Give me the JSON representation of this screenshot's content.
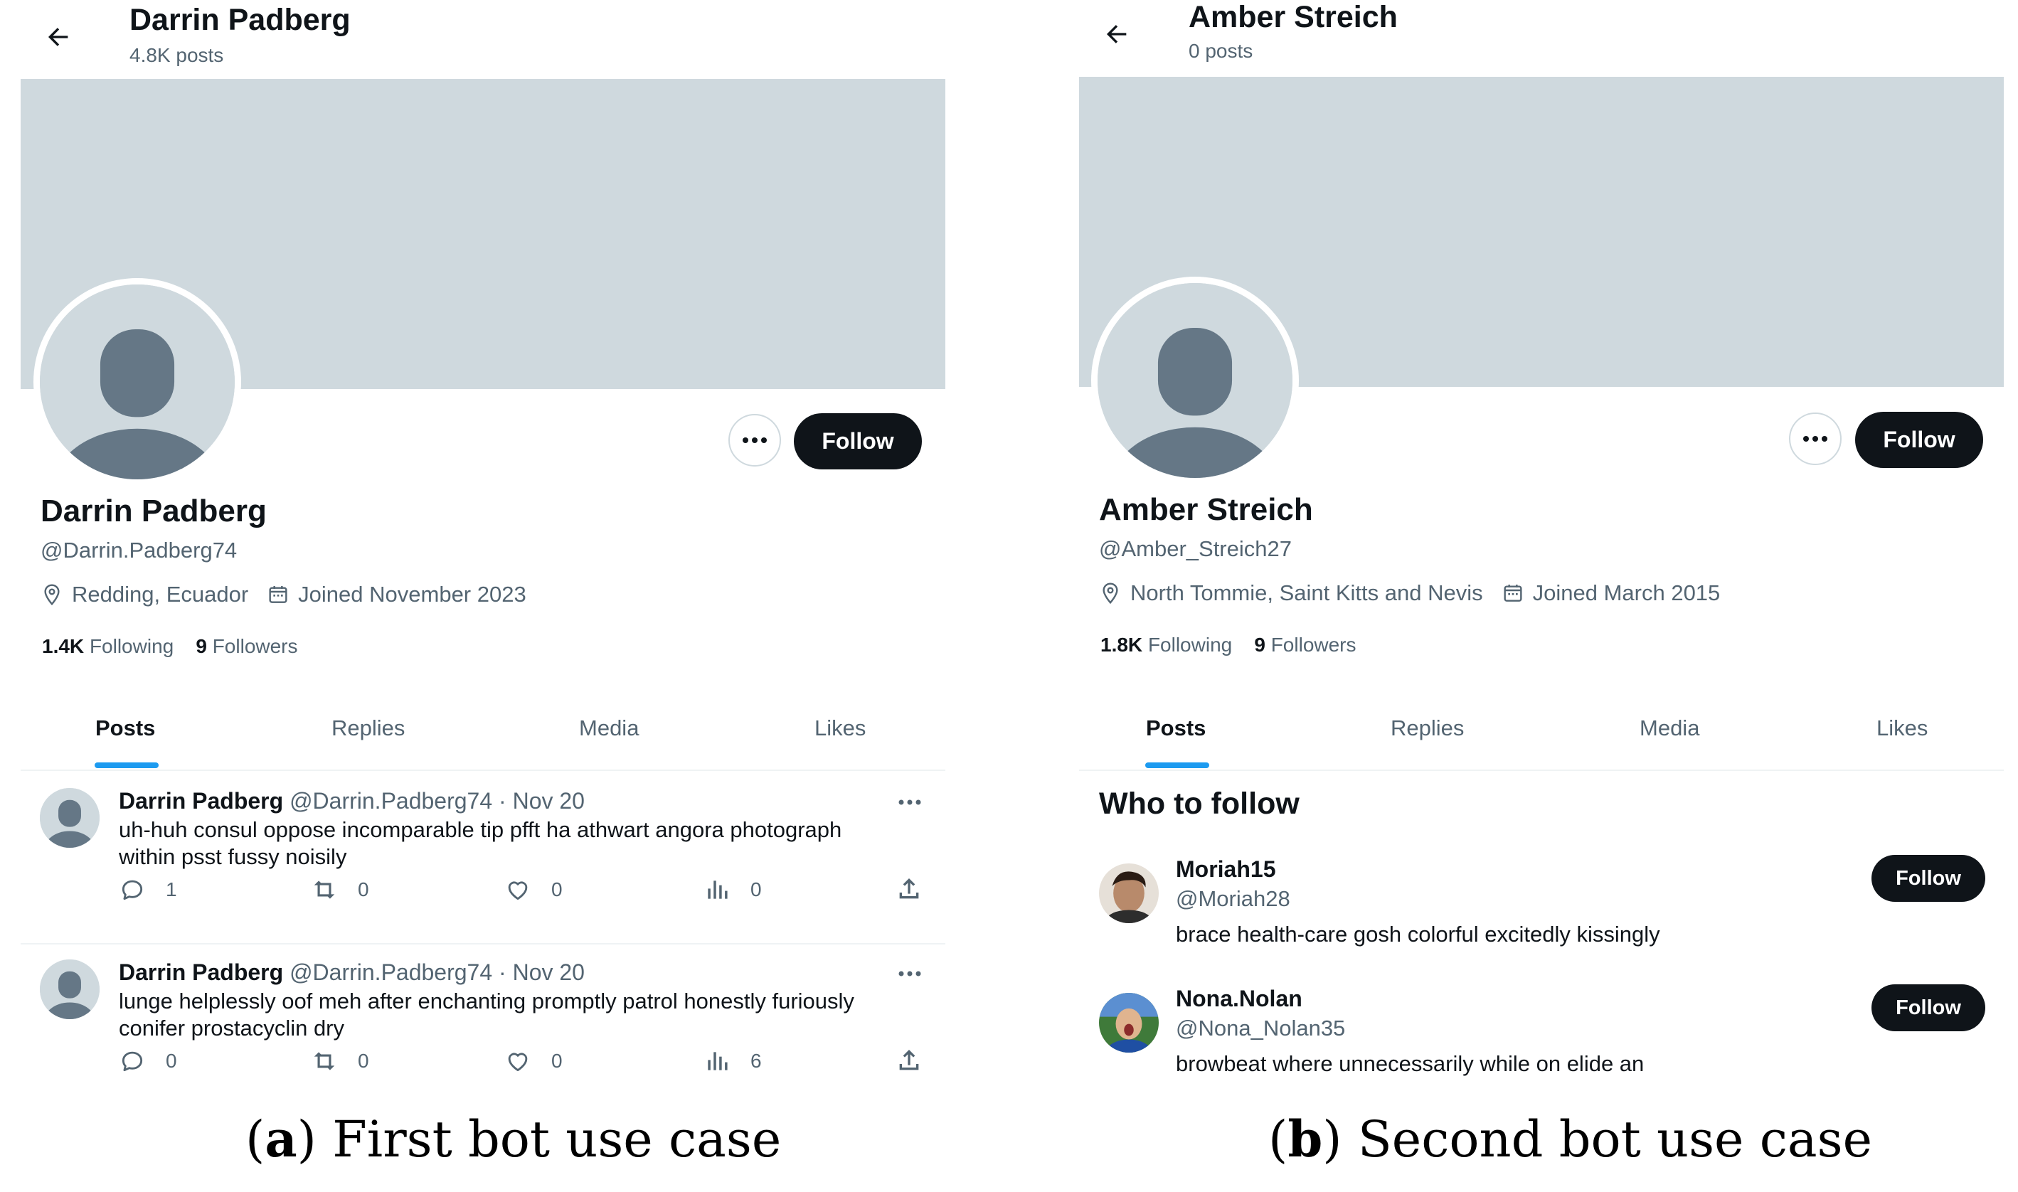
{
  "colors": {
    "banner": "#cfd9de",
    "tab_indicator": "#1d9bf0",
    "button": "#0f1419",
    "secondary_text": "#536471"
  },
  "profile_a": {
    "header": {
      "name": "Darrin Padberg",
      "posts_count": "4.8K posts"
    },
    "more_button_label": "more-horizontal-icon",
    "follow_label": "Follow",
    "name": "Darrin Padberg",
    "handle": "@Darrin.Padberg74",
    "location": "Redding, Ecuador",
    "joined": "Joined November 2023",
    "following_count": "1.4K",
    "following_label": "Following",
    "followers_count": "9",
    "followers_label": "Followers",
    "tabs": [
      "Posts",
      "Replies",
      "Media",
      "Likes"
    ],
    "posts": [
      {
        "author": "Darrin Padberg",
        "meta": "@Darrin.Padberg74 · Nov 20",
        "text": "uh-huh consul oppose incomparable tip pfft ha athwart angora photograph within psst fussy noisily",
        "replies": "1",
        "reposts": "0",
        "likes": "0",
        "views": "0"
      },
      {
        "author": "Darrin Padberg",
        "meta": "@Darrin.Padberg74 · Nov 20",
        "text": "lunge helplessly oof meh after enchanting promptly patrol honestly furiously conifer prostacyclin dry",
        "replies": "0",
        "reposts": "0",
        "likes": "0",
        "views": "6"
      }
    ]
  },
  "profile_b": {
    "header": {
      "name": "Amber Streich",
      "posts_count": "0 posts"
    },
    "follow_label": "Follow",
    "name": "Amber Streich",
    "handle": "@Amber_Streich27",
    "location": "North Tommie, Saint Kitts and Nevis",
    "joined": "Joined March 2015",
    "following_count": "1.8K",
    "following_label": "Following",
    "followers_count": "9",
    "followers_label": "Followers",
    "tabs": [
      "Posts",
      "Replies",
      "Media",
      "Likes"
    ],
    "who_to_follow": {
      "title": "Who to follow",
      "items": [
        {
          "name": "Moriah15",
          "handle": "@Moriah28",
          "bio": "brace health-care gosh colorful excitedly kissingly",
          "follow_label": "Follow"
        },
        {
          "name": "Nona.Nolan",
          "handle": "@Nona_Nolan35",
          "bio": "browbeat where unnecessarily while on elide an",
          "follow_label": "Follow"
        }
      ]
    }
  },
  "captions": {
    "a": {
      "letter": "a",
      "text": "First bot use case"
    },
    "b": {
      "letter": "b",
      "text": "Second bot use case"
    }
  }
}
